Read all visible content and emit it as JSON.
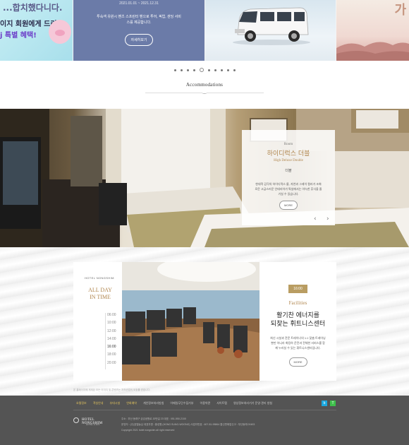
{
  "promo": {
    "card1": {
      "headline": "...합치했다니다.",
      "line1": "이지 회원에게 드리는",
      "line2": "j 특별 혜택!"
    },
    "card2": {
      "dates": "2021.01.01 ~ 2021.12.31",
      "desc": "투숙객 유원시 벤츠 스프린터 밴으로 투어, 픽업, 샌딩 서비스를 제공합니다.",
      "button": "자세히보기"
    },
    "card4": {
      "deco": "가"
    },
    "dot_count": 10,
    "active_dot": 4
  },
  "accommodations": {
    "title": "Accommodations",
    "room": {
      "small": "Room",
      "title": "하이디럭스 더블",
      "subtitle": "High Deluxe Double",
      "type": "더블",
      "desc": "현대적 감각의 하이디럭스 룸, 자연과 그레이 컬러가 조화로운 고급스러운 인테리어가 특실에서는 아늑한 휴식을 즐기실 수 있습니다.",
      "button": "MORE",
      "prev": "‹",
      "next": "›"
    }
  },
  "facility": {
    "brand": "HOTEL NONGSHIM",
    "all_day": [
      "ALL DAY",
      "IN TIME"
    ],
    "hours": [
      "06:00",
      "10:00",
      "12:00",
      "14:00",
      "16:00",
      "18:00",
      "20:00"
    ],
    "active_hour_index": 4,
    "time_badge": "16:00",
    "en_title": "Facilities",
    "title_line1": "활기찬 에너지를",
    "title_line2": "되찾는 휘트니스센터",
    "desc": "최신 시설과 전문 트레이너의 1:1 맞춤 트레이닝 뿐만 아니라 화킹하 운전과 전체한 서비스를 함께 누리실 수 있는 휘트니스센터입니다.",
    "button": "MORE",
    "notice": "본 홈페이지에 게재된 모든 이미지 및 콘텐츠는 저작권법의 보호를 받습니다."
  },
  "footer": {
    "nav": [
      {
        "label": "호텔정보",
        "highlight": true
      },
      {
        "label": "객실안내",
        "highlight": true
      },
      {
        "label": "부대시설",
        "highlight": true
      },
      {
        "label": "연회예약",
        "highlight": true
      },
      {
        "label": "개인정보처리방침",
        "highlight": false
      },
      {
        "label": "이메일무단수집거부",
        "highlight": false
      },
      {
        "label": "이용약관",
        "highlight": false
      },
      {
        "label": "사이트맵",
        "highlight": false
      },
      {
        "label": "영상정보처리기기 운영·관리 방침",
        "highlight": false
      }
    ],
    "sns_blog": "b",
    "sns_talk": "T",
    "logo": "HOTEL NONGSHIM",
    "logo_sub": "HOTEL & SPA",
    "info_line1": "주소 : 부산 동래구 금강공원로 20번길 23   대표 : 051-550-2100",
    "info_line2": "운영자 : (주)호텔농심   대표자명 : 황성원 (HONG SUNG-WOONG)   사업자번호 : 607-81-95864   통신판매업신고 : 부산동래 00493",
    "copyright": "Copyright 2021 hotel nongshim all right reserved"
  }
}
